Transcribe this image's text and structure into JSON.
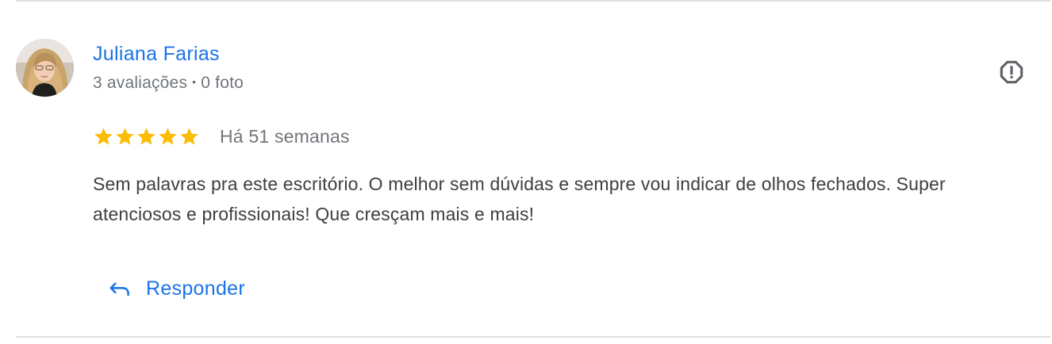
{
  "review": {
    "reviewer_name": "Juliana Farias",
    "reviews_count": "3 avaliações",
    "meta_separator": "•",
    "photos_count": "0 foto",
    "rating": 5,
    "rating_max": 5,
    "date": "Há 51 semanas",
    "text": "Sem palavras pra este escritório. O melhor sem dúvidas e sempre vou indicar de olhos fechados. Super atenciosos e profissionais! Que cresçam mais e mais!",
    "reply_label": "Responder"
  },
  "icons": {
    "flag": "report-flag-icon",
    "star": "star-icon",
    "reply": "reply-arrow-icon"
  },
  "colors": {
    "link_blue": "#1a73e8",
    "star_yellow": "#fbbc04",
    "meta_gray": "#70757a",
    "text_dark": "#3c4043",
    "divider": "#e0e0e0"
  }
}
